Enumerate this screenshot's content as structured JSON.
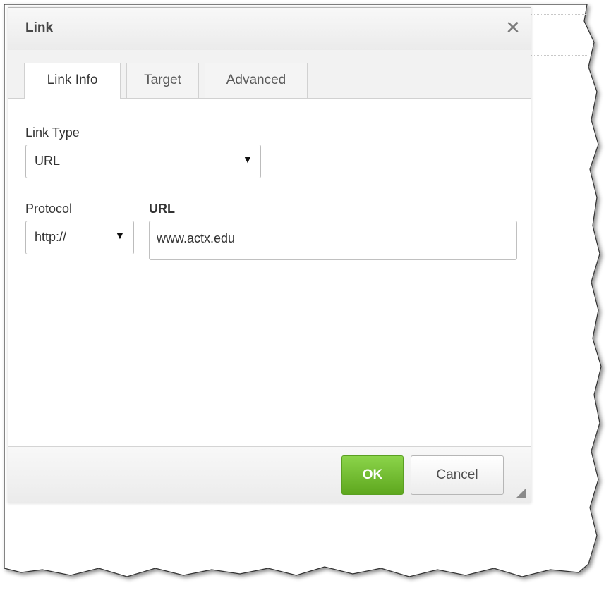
{
  "dialog": {
    "title": "Link",
    "close_icon": "close-icon"
  },
  "tabs": [
    {
      "label": "Link Info",
      "active": true
    },
    {
      "label": "Target",
      "active": false
    },
    {
      "label": "Advanced",
      "active": false
    }
  ],
  "link_type": {
    "label": "Link Type",
    "value": "URL"
  },
  "protocol": {
    "label": "Protocol",
    "value": "http://"
  },
  "url": {
    "label": "URL",
    "value": "www.actx.edu"
  },
  "footer": {
    "ok_label": "OK",
    "cancel_label": "Cancel"
  },
  "colors": {
    "ok_button": "#6cba2a",
    "title_text": "#474747"
  }
}
